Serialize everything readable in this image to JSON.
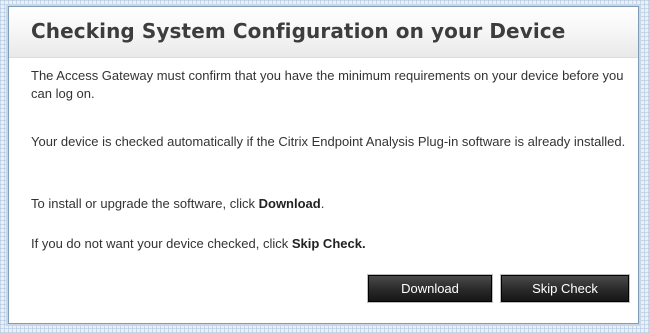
{
  "dialog": {
    "title": "Checking System Configuration on your Device",
    "paragraph1": "The Access Gateway must confirm that you have the minimum requirements on your device before you can log on.",
    "paragraph2": "Your device is checked automatically if the Citrix Endpoint Analysis Plug-in software is already installed.",
    "paragraph3_prefix": "To install or upgrade the software, click ",
    "paragraph3_bold": "Download",
    "paragraph3_suffix": ".",
    "paragraph4_prefix": "If you do not want your device checked, click ",
    "paragraph4_bold": "Skip Check."
  },
  "buttons": {
    "download_label": "Download",
    "skip_check_label": "Skip Check"
  },
  "colors": {
    "title_text": "#3d3d3d",
    "body_text": "#333333",
    "button_bg": "#2c2c2c",
    "button_text": "#ffffff",
    "dialog_border": "#7f9db9"
  }
}
